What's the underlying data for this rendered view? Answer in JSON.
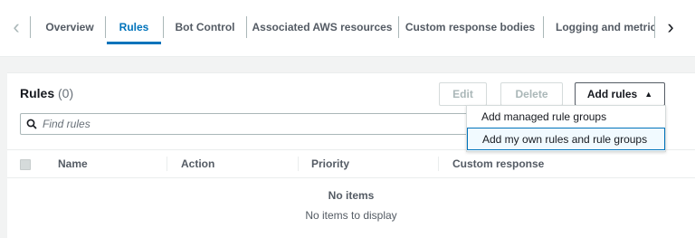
{
  "tabs": {
    "items": [
      {
        "label": "Overview",
        "active": false
      },
      {
        "label": "Rules",
        "active": true
      },
      {
        "label": "Bot Control",
        "active": false
      },
      {
        "label": "Associated AWS resources",
        "active": false
      },
      {
        "label": "Custom response bodies",
        "active": false
      },
      {
        "label": "Logging and metrics",
        "active": false
      }
    ],
    "prev_icon": "chevron-left-icon",
    "next_icon": "chevron-right-icon"
  },
  "rules": {
    "title": "Rules",
    "count": "(0)",
    "buttons": {
      "edit": "Edit",
      "delete": "Delete",
      "add": "Add rules"
    },
    "search": {
      "placeholder": "Find rules",
      "icon": "search-icon"
    },
    "table": {
      "columns": [
        "Name",
        "Action",
        "Priority",
        "Custom response"
      ],
      "empty_title": "No items",
      "empty_subtitle": "No items to display"
    }
  },
  "dropdown": {
    "items": [
      {
        "label": "Add managed rule groups"
      },
      {
        "label": "Add my own rules and rule groups"
      }
    ]
  },
  "colors": {
    "accent": "#0073bb",
    "text": "#16191f",
    "muted": "#545b64",
    "background": "#f2f3f3"
  }
}
